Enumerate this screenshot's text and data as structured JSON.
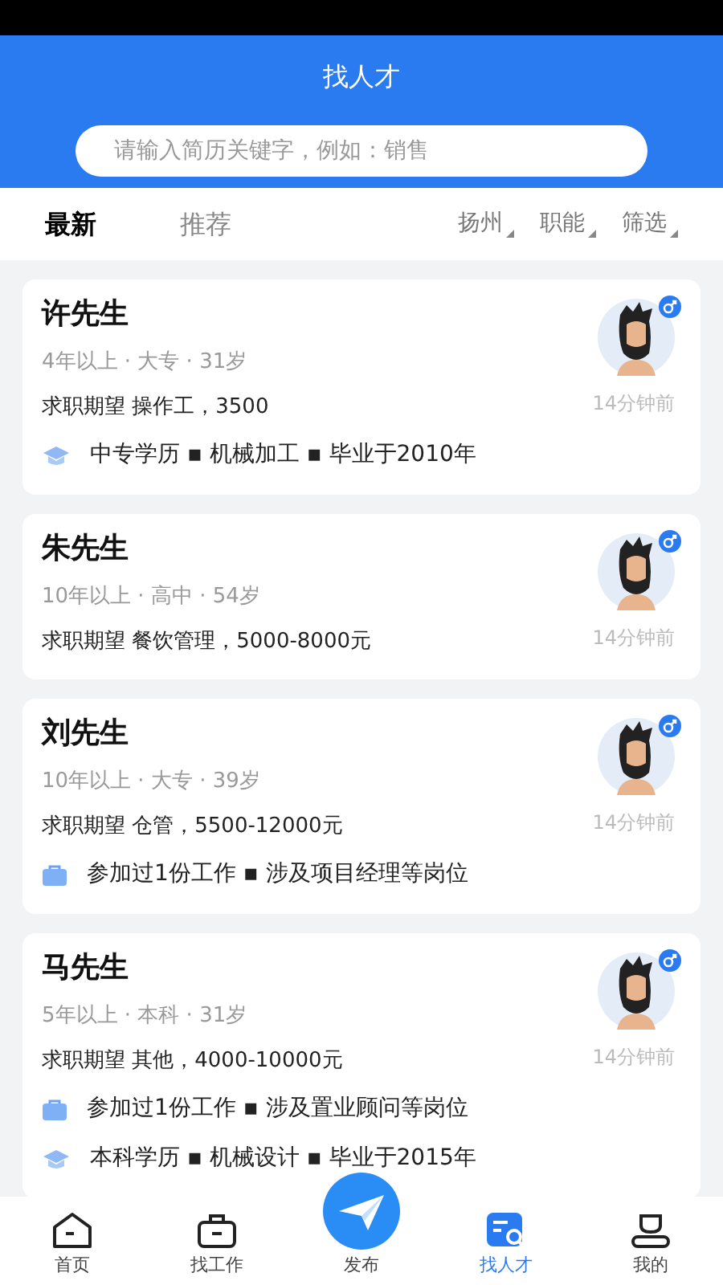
{
  "header": {
    "title": "找人才"
  },
  "search": {
    "placeholder": "请输入简历关键字，例如：销售"
  },
  "tabs": [
    {
      "label": "最新",
      "selected": true
    },
    {
      "label": "推荐",
      "selected": false
    }
  ],
  "filters": [
    "扬州",
    "职能",
    "筛选"
  ],
  "candidates": [
    {
      "name": "许先生",
      "meta": "4年以上 · 大专 · 31岁",
      "expectation": "求职期望 操作工，3500",
      "time": "14分钟前",
      "details": [
        {
          "kind": "education",
          "text": "中专学历 ▪ 机械加工 ▪ 毕业于2010年"
        }
      ]
    },
    {
      "name": "朱先生",
      "meta": "10年以上 · 高中 · 54岁",
      "expectation": "求职期望 餐饮管理，5000-8000元",
      "time": "14分钟前"
    },
    {
      "name": "刘先生",
      "meta": "10年以上 · 大专 · 39岁",
      "expectation": "求职期望 仓管，5500-12000元",
      "time": "14分钟前",
      "details": [
        {
          "kind": "work",
          "text": "参加过1份工作 ▪ 涉及项目经理等岗位"
        }
      ]
    },
    {
      "name": "马先生",
      "meta": "5年以上 · 本科 · 31岁",
      "expectation": "求职期望 其他，4000-10000元",
      "time": "14分钟前",
      "details": [
        {
          "kind": "work",
          "text": "参加过1份工作 ▪ 涉及置业顾问等岗位"
        },
        {
          "kind": "education",
          "text": "本科学历 ▪ 机械设计 ▪ 毕业于2015年"
        }
      ]
    }
  ],
  "nav": [
    {
      "kind": "home",
      "label": "首页",
      "selected": false
    },
    {
      "kind": "jobs",
      "label": "找工作",
      "selected": false
    },
    {
      "kind": "publish",
      "label": "发布",
      "selected": false
    },
    {
      "kind": "talent",
      "label": "找人才",
      "selected": true
    },
    {
      "kind": "profile",
      "label": "我的",
      "selected": false
    }
  ]
}
